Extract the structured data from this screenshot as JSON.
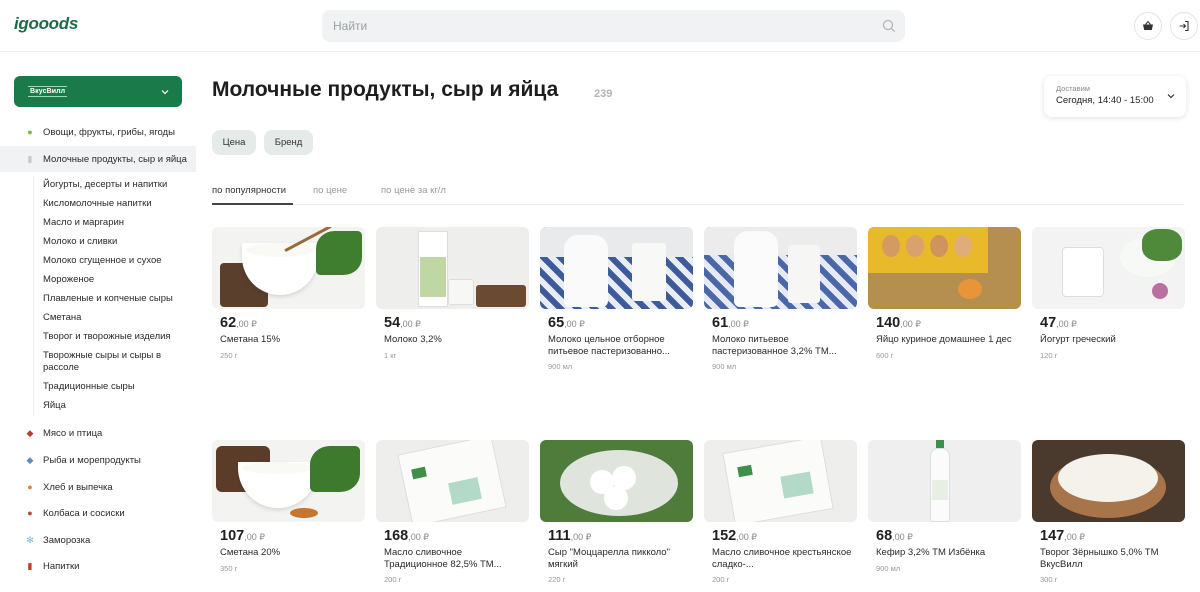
{
  "header": {
    "logo": "igooods",
    "search_placeholder": "Найти",
    "cart_icon": "basket-icon",
    "login_icon": "login-icon"
  },
  "sidebar": {
    "store": "ВкусВилл",
    "categories": [
      {
        "label": "Овощи, фрукты, грибы, ягоды",
        "icon": "apple-icon"
      },
      {
        "label": "Молочные продукты, сыр и яйца",
        "icon": "milk-icon"
      },
      {
        "label": "Мясо и птица",
        "icon": "meat-icon"
      },
      {
        "label": "Рыба и морепродукты",
        "icon": "fish-icon"
      },
      {
        "label": "Хлеб и выпечка",
        "icon": "bread-icon"
      },
      {
        "label": "Колбаса и сосиски",
        "icon": "sausage-icon"
      },
      {
        "label": "Заморозка",
        "icon": "snowflake-icon"
      },
      {
        "label": "Напитки",
        "icon": "drink-icon"
      }
    ],
    "subcategories": [
      "Йогурты, десерты и напитки",
      "Кисломолочные напитки",
      "Масло и маргарин",
      "Молоко и сливки",
      "Молоко сгущенное и сухое",
      "Мороженое",
      "Плавленые и копченые сыры",
      "Сметана",
      "Творог и творожные изделия",
      "Творожные сыры и сыры в рассоле",
      "Традиционные сыры",
      "Яйца"
    ]
  },
  "main": {
    "title": "Молочные продукты, сыр и яйца",
    "count": "239",
    "filters": [
      "Цена",
      "Бренд"
    ],
    "sort": [
      "по популярности",
      "по цене",
      "по цене за кг/л"
    ],
    "delivery_label": "Доставим",
    "delivery_value": "Сегодня, 14:40 - 15:00"
  },
  "products": [
    {
      "price": "62",
      "cents": ",00 ₽",
      "name": "Сметана 15%",
      "weight": "250 г"
    },
    {
      "price": "54",
      "cents": ",00 ₽",
      "name": "Молоко 3,2%",
      "weight": "1 кг"
    },
    {
      "price": "65",
      "cents": ",00 ₽",
      "name": "Молоко цельное отборное питьевое пастеризованно...",
      "weight": "900 мл"
    },
    {
      "price": "61",
      "cents": ",00 ₽",
      "name": "Молоко питьевое пастеризованное 3,2% ТМ...",
      "weight": "900 мл"
    },
    {
      "price": "140",
      "cents": ",00 ₽",
      "name": "Яйцо куриное домашнее 1 дес",
      "weight": "600 г"
    },
    {
      "price": "47",
      "cents": ",00 ₽",
      "name": "Йогурт греческий",
      "weight": "120 г"
    },
    {
      "price": "107",
      "cents": ",00 ₽",
      "name": "Сметана 20%",
      "weight": "350 г"
    },
    {
      "price": "168",
      "cents": ",00 ₽",
      "name": "Масло сливочное Традиционное 82,5% ТМ...",
      "weight": "200 г"
    },
    {
      "price": "111",
      "cents": ",00 ₽",
      "name": "Сыр \"Моццарелла пикколо\" мягкий",
      "weight": "220 г"
    },
    {
      "price": "152",
      "cents": ",00 ₽",
      "name": "Масло сливочное крестьянское сладко-...",
      "weight": "200 г"
    },
    {
      "price": "68",
      "cents": ",00 ₽",
      "name": "Кефир 3,2% ТМ Избёнка",
      "weight": "900 мл"
    },
    {
      "price": "147",
      "cents": ",00 ₽",
      "name": "Творог Зёрнышко 5,0% ТМ ВкусВилл",
      "weight": "300 г"
    }
  ],
  "colors": {
    "brand": "#1b7a4a",
    "chip": "#e4ebe9"
  }
}
